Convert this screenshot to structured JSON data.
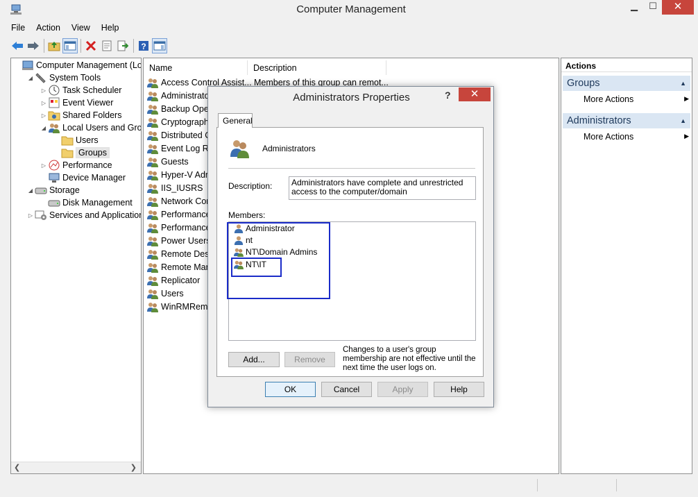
{
  "window": {
    "title": "Computer Management",
    "minimize": "▁",
    "maximize": "☐",
    "close": "✕"
  },
  "menu": [
    "File",
    "Action",
    "View",
    "Help"
  ],
  "toolbar": [
    "back-icon",
    "forward-icon",
    "up-folder-icon",
    "show-hide-tree-icon",
    "delete-icon",
    "properties-icon",
    "export-list-icon",
    "help-icon",
    "show-hide-action-pane-icon"
  ],
  "tree": [
    {
      "label": "Computer Management (Local",
      "level": 0,
      "expander": "",
      "icon": "computer-management-icon"
    },
    {
      "label": "System Tools",
      "level": 1,
      "expander": "◢",
      "icon": "system-tools-icon"
    },
    {
      "label": "Task Scheduler",
      "level": 2,
      "expander": "▷",
      "icon": "task-scheduler-icon"
    },
    {
      "label": "Event Viewer",
      "level": 2,
      "expander": "▷",
      "icon": "event-viewer-icon"
    },
    {
      "label": "Shared Folders",
      "level": 2,
      "expander": "▷",
      "icon": "shared-folders-icon"
    },
    {
      "label": "Local Users and Groups",
      "level": 2,
      "expander": "◢",
      "icon": "local-users-groups-icon"
    },
    {
      "label": "Users",
      "level": 3,
      "expander": "",
      "icon": "folder-icon"
    },
    {
      "label": "Groups",
      "level": 3,
      "expander": "",
      "icon": "folder-icon"
    },
    {
      "label": "Performance",
      "level": 2,
      "expander": "▷",
      "icon": "performance-icon"
    },
    {
      "label": "Device Manager",
      "level": 2,
      "expander": "",
      "icon": "device-manager-icon"
    },
    {
      "label": "Storage",
      "level": 1,
      "expander": "◢",
      "icon": "storage-icon"
    },
    {
      "label": "Disk Management",
      "level": 2,
      "expander": "",
      "icon": "disk-management-icon"
    },
    {
      "label": "Services and Applications",
      "level": 1,
      "expander": "▷",
      "icon": "services-applications-icon"
    }
  ],
  "list": {
    "columns": [
      "Name",
      "Description"
    ],
    "rows": [
      {
        "name": "Access Control Assist...",
        "description": "Members of this group can remot..."
      },
      {
        "name": "Administrato",
        "description": ""
      },
      {
        "name": "Backup Oper",
        "description": ""
      },
      {
        "name": "Cryptograph",
        "description": ""
      },
      {
        "name": "Distributed C",
        "description": ""
      },
      {
        "name": "Event Log Re",
        "description": ""
      },
      {
        "name": "Guests",
        "description": ""
      },
      {
        "name": "Hyper-V Adn",
        "description": ""
      },
      {
        "name": "IIS_IUSRS",
        "description": ""
      },
      {
        "name": "Network Cor",
        "description": ""
      },
      {
        "name": "Performance",
        "description": ""
      },
      {
        "name": "Performance",
        "description": ""
      },
      {
        "name": "Power Users",
        "description": ""
      },
      {
        "name": "Remote Desk",
        "description": ""
      },
      {
        "name": "Remote Man",
        "description": ""
      },
      {
        "name": "Replicator",
        "description": ""
      },
      {
        "name": "Users",
        "description": ""
      },
      {
        "name": "WinRMRemo",
        "description": ""
      }
    ]
  },
  "actions": {
    "title": "Actions",
    "sections": [
      {
        "header": "Groups",
        "item": "More Actions"
      },
      {
        "header": "Administrators",
        "item": "More Actions"
      }
    ]
  },
  "dialog": {
    "title": "Administrators Properties",
    "help": "?",
    "close": "✕",
    "tab": "General",
    "group_name": "Administrators",
    "description_label": "Description:",
    "description_value": "Administrators have complete and unrestricted access to the computer/domain",
    "members_label": "Members:",
    "members": [
      {
        "name": "Administrator",
        "icon": "user-icon"
      },
      {
        "name": "nt",
        "icon": "user-icon"
      },
      {
        "name": "NT\\Domain Admins",
        "icon": "group-icon"
      },
      {
        "name": "NT\\IT",
        "icon": "group-icon"
      }
    ],
    "buttons": {
      "add": "Add...",
      "remove": "Remove",
      "ok": "OK",
      "cancel": "Cancel",
      "apply": "Apply",
      "help": "Help"
    },
    "note": "Changes to a user's group membership are not effective until the next time the user logs on."
  },
  "colors": {
    "close_red": "#c7453c",
    "action_header": "#dae6f3",
    "highlight_box": "#1a2bc8"
  }
}
